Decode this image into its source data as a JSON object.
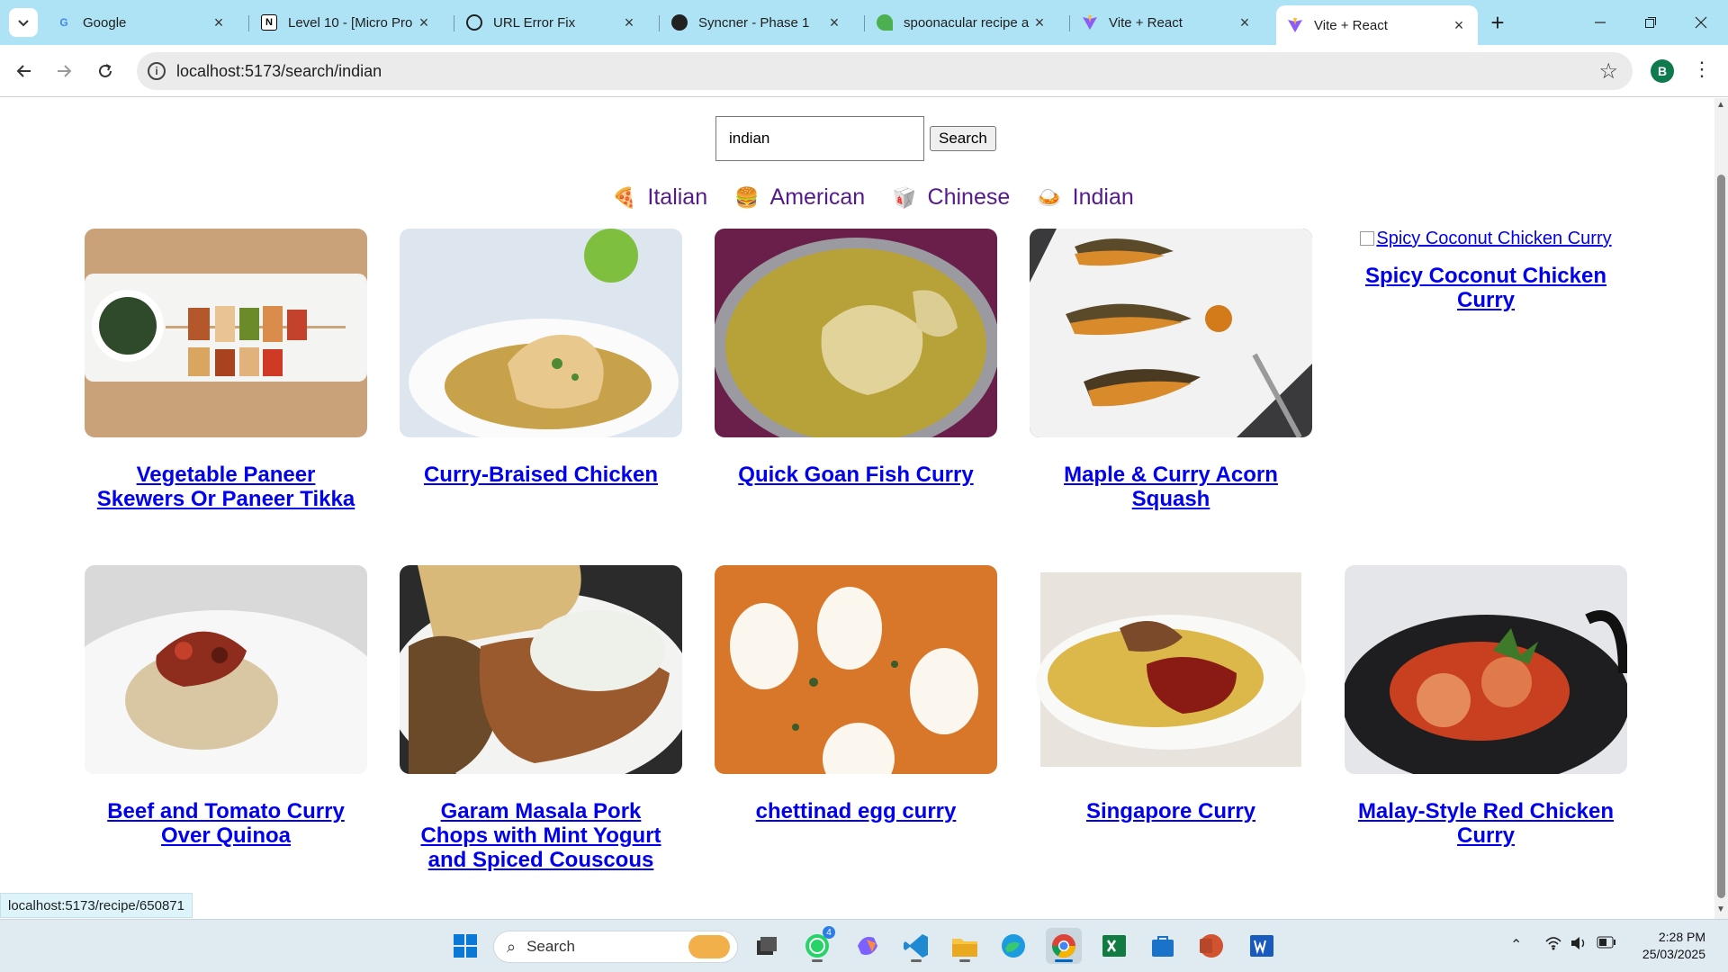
{
  "browser": {
    "tabs": [
      {
        "title": "Google",
        "icon": "google-icon"
      },
      {
        "title": "Level 10 - [Micro Pro",
        "icon": "notion-icon"
      },
      {
        "title": "URL Error Fix",
        "icon": "chatgpt-icon"
      },
      {
        "title": "Syncner - Phase 1",
        "icon": "syncner-icon"
      },
      {
        "title": "spoonacular recipe a",
        "icon": "spoonacular-icon"
      },
      {
        "title": "Vite + React",
        "icon": "vite-icon"
      },
      {
        "title": "Vite + React",
        "icon": "vite-icon"
      }
    ],
    "active_tab_index": 6,
    "url": "localhost:5173/search/indian",
    "profile_initial": "B"
  },
  "search": {
    "value": "indian",
    "button_label": "Search"
  },
  "cuisines": [
    {
      "label": "Italian",
      "icon": "pizza-icon"
    },
    {
      "label": "American",
      "icon": "burger-icon"
    },
    {
      "label": "Chinese",
      "icon": "takeout-box-icon"
    },
    {
      "label": "Indian",
      "icon": "curry-bowl-icon"
    }
  ],
  "recipes": [
    {
      "title": "Vegetable Paneer Skewers Or Paneer Tikka"
    },
    {
      "title": "Curry-Braised Chicken"
    },
    {
      "title": "Quick Goan Fish Curry"
    },
    {
      "title": "Maple & Curry Acorn Squash"
    },
    {
      "title": "Spicy Coconut Chicken Curry",
      "alt": "Spicy Coconut Chicken Curry"
    },
    {
      "title": "Beef and Tomato Curry Over Quinoa"
    },
    {
      "title": "Garam Masala Pork Chops with Mint Yogurt and Spiced Couscous"
    },
    {
      "title": "chettinad egg curry"
    },
    {
      "title": "Singapore Curry"
    },
    {
      "title": "Malay-Style Red Chicken Curry"
    }
  ],
  "status_bar_url": "localhost:5173/recipe/650871",
  "taskbar": {
    "search_placeholder": "Search",
    "whatsapp_badge": "4",
    "time": "2:28 PM",
    "date": "25/03/2025"
  }
}
